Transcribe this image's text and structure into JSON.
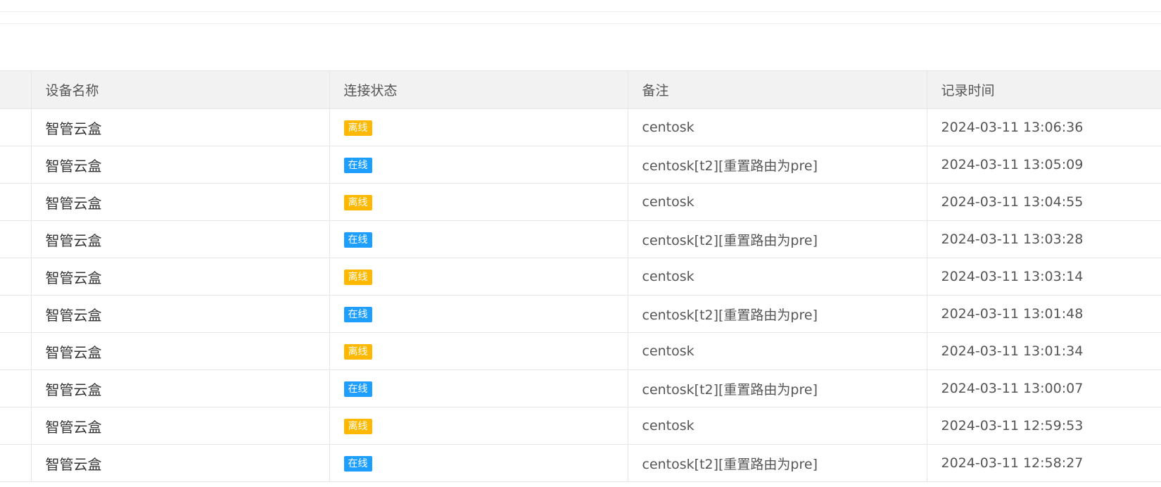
{
  "colors": {
    "offline_badge": "#FFB800",
    "online_badge": "#1E9FFF",
    "header_bg": "#f2f2f2",
    "border": "#e6e6e6"
  },
  "table": {
    "headers": {
      "name": "设备名称",
      "status": "连接状态",
      "remark": "备注",
      "time": "记录时间"
    },
    "rows": [
      {
        "name": "智管云盒",
        "status": "离线",
        "status_type": "offline",
        "remark": "centosk",
        "time": "2024-03-11 13:06:36"
      },
      {
        "name": "智管云盒",
        "status": "在线",
        "status_type": "online",
        "remark": "centosk[t2][重置路由为pre]",
        "time": "2024-03-11 13:05:09"
      },
      {
        "name": "智管云盒",
        "status": "离线",
        "status_type": "offline",
        "remark": "centosk",
        "time": "2024-03-11 13:04:55"
      },
      {
        "name": "智管云盒",
        "status": "在线",
        "status_type": "online",
        "remark": "centosk[t2][重置路由为pre]",
        "time": "2024-03-11 13:03:28"
      },
      {
        "name": "智管云盒",
        "status": "离线",
        "status_type": "offline",
        "remark": "centosk",
        "time": "2024-03-11 13:03:14"
      },
      {
        "name": "智管云盒",
        "status": "在线",
        "status_type": "online",
        "remark": "centosk[t2][重置路由为pre]",
        "time": "2024-03-11 13:01:48"
      },
      {
        "name": "智管云盒",
        "status": "离线",
        "status_type": "offline",
        "remark": "centosk",
        "time": "2024-03-11 13:01:34"
      },
      {
        "name": "智管云盒",
        "status": "在线",
        "status_type": "online",
        "remark": "centosk[t2][重置路由为pre]",
        "time": "2024-03-11 13:00:07"
      },
      {
        "name": "智管云盒",
        "status": "离线",
        "status_type": "offline",
        "remark": "centosk",
        "time": "2024-03-11 12:59:53"
      },
      {
        "name": "智管云盒",
        "status": "在线",
        "status_type": "online",
        "remark": "centosk[t2][重置路由为pre]",
        "time": "2024-03-11 12:58:27"
      }
    ]
  }
}
